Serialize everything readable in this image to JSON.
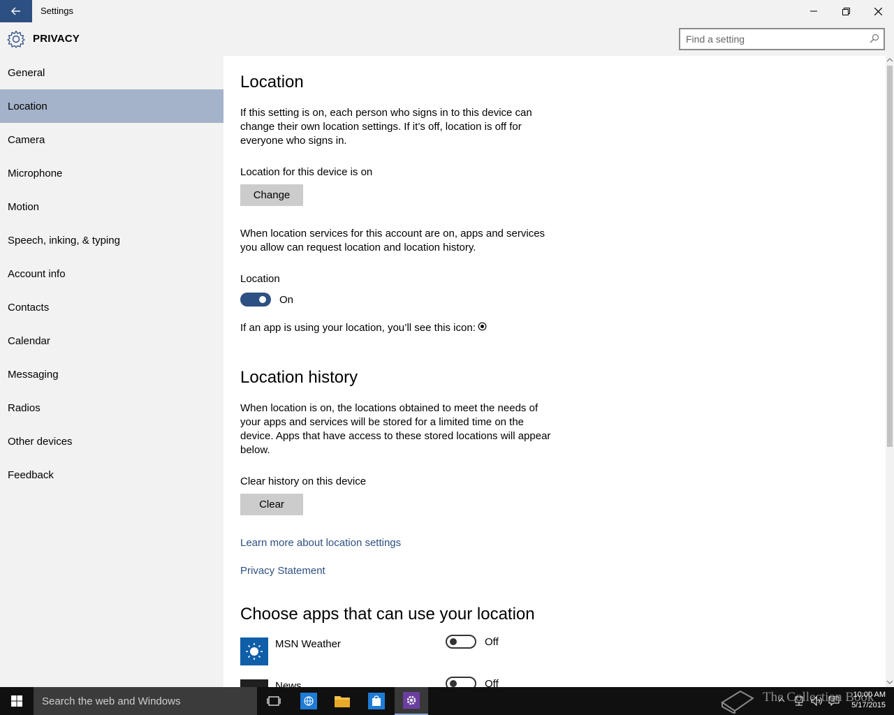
{
  "window": {
    "title": "Settings"
  },
  "header": {
    "title": "PRIVACY",
    "search_placeholder": "Find a setting"
  },
  "sidebar": {
    "items": [
      {
        "label": "General",
        "selected": false
      },
      {
        "label": "Location",
        "selected": true
      },
      {
        "label": "Camera",
        "selected": false
      },
      {
        "label": "Microphone",
        "selected": false
      },
      {
        "label": "Motion",
        "selected": false
      },
      {
        "label": "Speech, inking, & typing",
        "selected": false
      },
      {
        "label": "Account info",
        "selected": false
      },
      {
        "label": "Contacts",
        "selected": false
      },
      {
        "label": "Calendar",
        "selected": false
      },
      {
        "label": "Messaging",
        "selected": false
      },
      {
        "label": "Radios",
        "selected": false
      },
      {
        "label": "Other devices",
        "selected": false
      },
      {
        "label": "Feedback",
        "selected": false
      }
    ]
  },
  "location": {
    "heading": "Location",
    "intro": "If this setting is on, each person who signs in to this device can change their own location settings. If it’s off, location is off for everyone who signs in.",
    "device_status": "Location for this device is on",
    "change_label": "Change",
    "services_text": "When location services for this account are on, apps and services you allow can request location and location history.",
    "toggle_label": "Location",
    "toggle_state": "On",
    "icon_note": "If an app is using your location, you’ll see this icon:"
  },
  "history": {
    "heading": "Location history",
    "text": "When location is on, the locations obtained to meet the needs of your apps and services will be stored for a limited time on the device. Apps that have access to these stored locations will appear below.",
    "clear_label_text": "Clear history on this device",
    "clear_button": "Clear",
    "learn_more": "Learn more about location settings",
    "privacy_statement": "Privacy Statement"
  },
  "apps": {
    "heading": "Choose apps that can use your location",
    "items": [
      {
        "name": "MSN Weather",
        "state": "Off",
        "icon_color": "#0e5ea8"
      },
      {
        "name": "News",
        "state": "Off",
        "icon_color": "#1f1f1f"
      }
    ]
  },
  "taskbar": {
    "search_placeholder": "Search the web and Windows",
    "watermark": "The Collection Book",
    "time": "10:00 AM",
    "date": "5/17/2015"
  },
  "colors": {
    "accent": "#2d5083",
    "selected_nav": "#a4b3c9",
    "sidebar_bg": "#f2f2f2"
  }
}
